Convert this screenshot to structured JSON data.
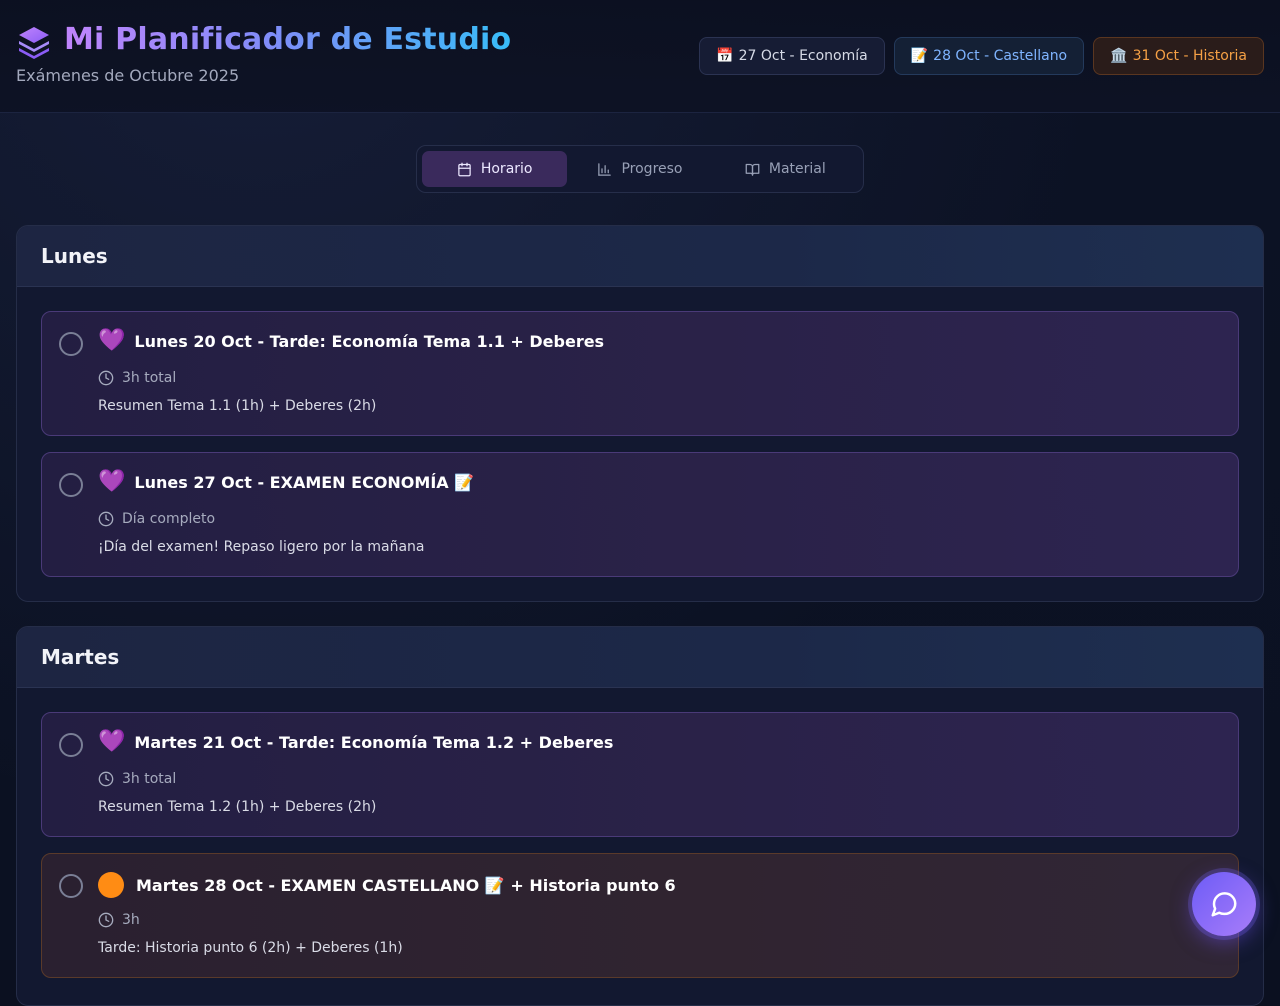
{
  "header": {
    "title": "Mi Planificador de Estudio",
    "subtitle": "Exámenes de Octubre 2025",
    "logo_icon": "layers-icon",
    "exam_chips": [
      {
        "emoji": "📅",
        "label": "27 Oct - Economía",
        "color": "#d6dae6"
      },
      {
        "emoji": "📝",
        "label": "28 Oct - Castellano",
        "color": "#7fb4ff"
      },
      {
        "emoji": "🏛️",
        "label": "31 Oct - Historia",
        "color": "#f5a045"
      }
    ]
  },
  "tabs": [
    {
      "label": "Horario",
      "icon": "calendar-icon",
      "active": true
    },
    {
      "label": "Progreso",
      "icon": "bar-chart-icon",
      "active": false
    },
    {
      "label": "Material",
      "icon": "book-open-icon",
      "active": false
    }
  ],
  "days": [
    {
      "name": "Lunes",
      "tasks": [
        {
          "marker": "💜",
          "title": "Lunes 20 Oct - Tarde: Economía Tema 1.1 + Deberes",
          "duration": "3h total",
          "description": "Resumen Tema 1.1 (1h) + Deberes (2h)",
          "completed": false
        },
        {
          "marker": "💜",
          "title": "Lunes 27 Oct - EXAMEN ECONOMÍA 📝",
          "duration": "Día completo",
          "description": "¡Día del examen! Repaso ligero por la mañana",
          "completed": false
        }
      ]
    },
    {
      "name": "Martes",
      "tasks": [
        {
          "marker": "💜",
          "title": "Martes 21 Oct - Tarde: Economía Tema 1.2 + Deberes",
          "duration": "3h total",
          "description": "Resumen Tema 1.2 (1h) + Deberes (2h)",
          "completed": false
        },
        {
          "marker": "orange-circle",
          "title": "Martes 28 Oct - EXAMEN CASTELLANO 📝 + Historia punto 6",
          "duration": "3h",
          "description": "Tarde: Historia punto 6 (2h) + Deberes (1h)",
          "completed": false
        }
      ]
    }
  ],
  "colors": {
    "accent_purple": "#b052ff",
    "accent_orange": "#ff8c14",
    "active_tab": "#3a2a5c"
  },
  "chat_button_icon": "message-circle-icon"
}
